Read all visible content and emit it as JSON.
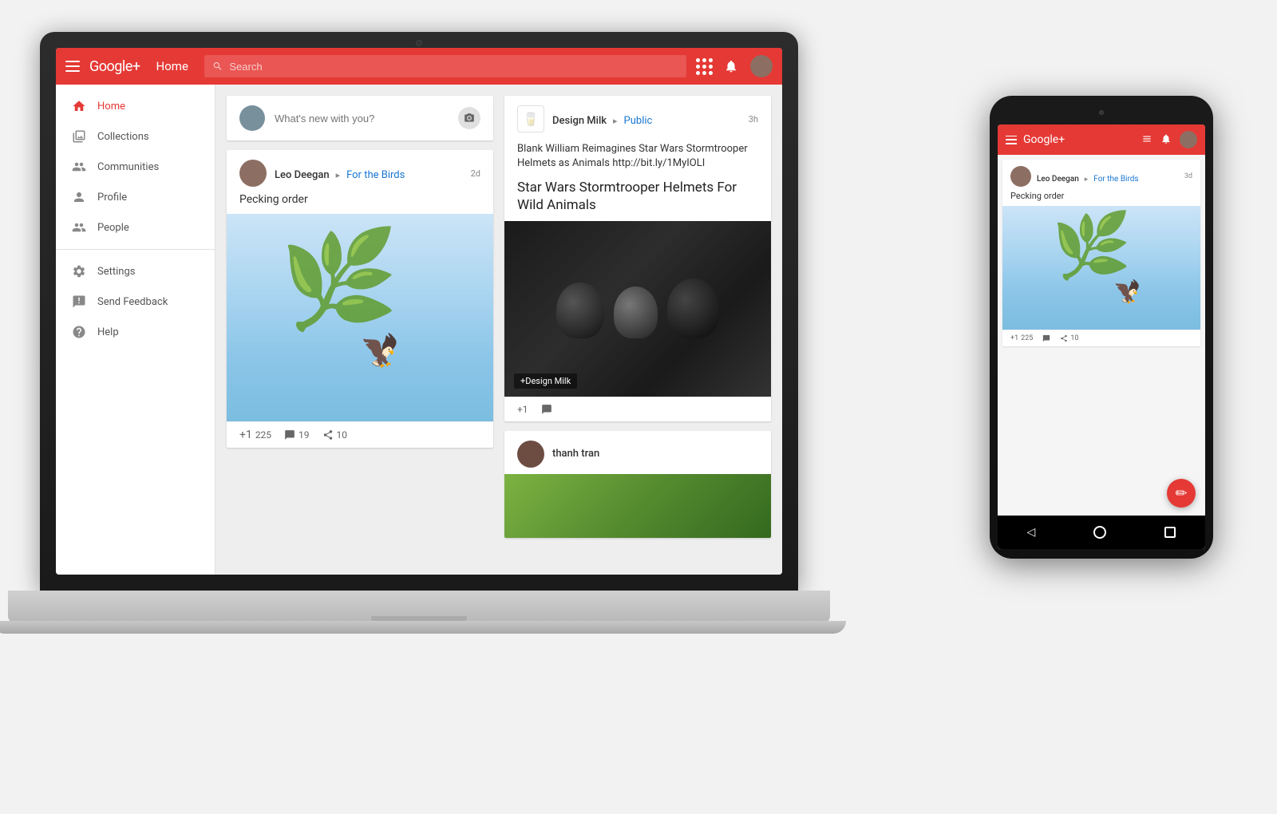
{
  "app": {
    "name": "Google+",
    "header": {
      "title": "Home",
      "search_placeholder": "Search",
      "hamburger_label": "Menu"
    },
    "sidebar": {
      "items": [
        {
          "id": "home",
          "label": "Home",
          "icon": "home-icon",
          "active": true
        },
        {
          "id": "collections",
          "label": "Collections",
          "icon": "collections-icon"
        },
        {
          "id": "communities",
          "label": "Communities",
          "icon": "communities-icon"
        },
        {
          "id": "profile",
          "label": "Profile",
          "icon": "profile-icon"
        },
        {
          "id": "people",
          "label": "People",
          "icon": "people-icon"
        }
      ],
      "secondary_items": [
        {
          "id": "settings",
          "label": "Settings",
          "icon": "settings-icon"
        },
        {
          "id": "feedback",
          "label": "Send Feedback",
          "icon": "feedback-icon"
        },
        {
          "id": "help",
          "label": "Help",
          "icon": "help-icon"
        }
      ]
    },
    "new_post": {
      "placeholder": "What's new with you?"
    },
    "posts": [
      {
        "id": "post1",
        "author": "Leo Deegan",
        "collection": "For the Birds",
        "time": "2d",
        "title": "Pecking order",
        "likes": "225",
        "comments": "19",
        "shares": "10"
      },
      {
        "id": "post2",
        "author": "Design Milk",
        "audience": "Public",
        "time": "3h",
        "subtitle": "Blank William Reimagines Star Wars Stormtrooper Helmets as Animals http://bit.ly/1MyIOLI",
        "headline": "Star Wars Stormtrooper Helmets For Wild Animals",
        "badge": "+Design Milk"
      },
      {
        "id": "post3",
        "author": "thanh tran"
      }
    ],
    "phone": {
      "post": {
        "author": "Leo Deegan",
        "collection": "For the Birds",
        "time": "3d",
        "title": "Pecking order",
        "likes": "225",
        "comments": "",
        "shares": "10"
      }
    }
  }
}
